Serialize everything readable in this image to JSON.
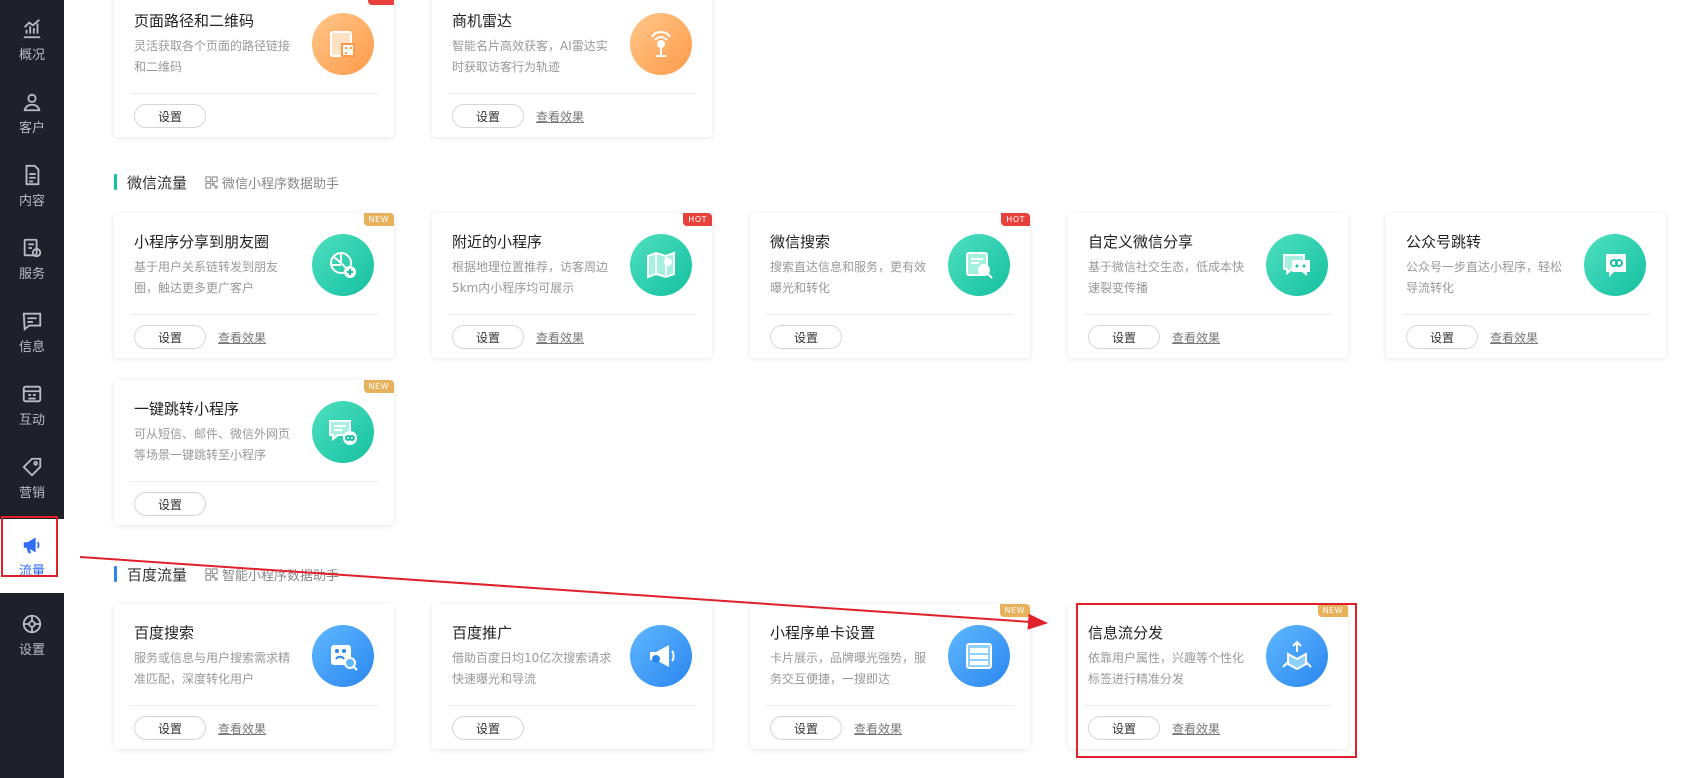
{
  "sidebar": {
    "items": [
      {
        "label": "概况",
        "icon": "chart-icon"
      },
      {
        "label": "客户",
        "icon": "user-icon"
      },
      {
        "label": "内容",
        "icon": "document-icon"
      },
      {
        "label": "服务",
        "icon": "service-icon"
      },
      {
        "label": "信息",
        "icon": "message-icon"
      },
      {
        "label": "互动",
        "icon": "interaction-icon"
      },
      {
        "label": "营销",
        "icon": "tag-icon"
      },
      {
        "label": "流量",
        "icon": "megaphone-icon"
      },
      {
        "label": "设置",
        "icon": "gear-icon"
      }
    ],
    "active": "流量"
  },
  "top_cards": [
    {
      "title": "页面路径和二维码",
      "desc": "灵活获取各个页面的路径链接和二维码",
      "button": "设置",
      "link": "",
      "icon": "qrcode-page-icon"
    },
    {
      "title": "商机雷达",
      "desc": "智能名片高效获客，AI雷达实时获取访客行为轨迹",
      "button": "设置",
      "link": "查看效果",
      "icon": "radar-icon"
    }
  ],
  "sections": [
    {
      "name": "微信流量",
      "helper": "微信小程序数据助手",
      "cards": [
        {
          "title": "小程序分享到朋友圈",
          "desc": "基于用户关系链转发到朋友圈，触达更多更广客户",
          "button": "设置",
          "link": "查看效果",
          "badge": "NEW",
          "icon": "moments-icon"
        },
        {
          "title": "附近的小程序",
          "desc": "根据地理位置推荐，访客周边5km内小程序均可展示",
          "button": "设置",
          "link": "查看效果",
          "badge": "HOT",
          "icon": "map-icon"
        },
        {
          "title": "微信搜索",
          "desc": "搜索直达信息和服务，更有效曝光和转化",
          "button": "设置",
          "link": "",
          "badge": "HOT",
          "icon": "search-page-icon"
        },
        {
          "title": "自定义微信分享",
          "desc": "基于微信社交生态，低成本快速裂变传播",
          "button": "设置",
          "link": "查看效果",
          "badge": "",
          "icon": "wechat-icon"
        },
        {
          "title": "公众号跳转",
          "desc": "公众号一步直达小程序，轻松导流转化",
          "button": "设置",
          "link": "查看效果",
          "badge": "",
          "icon": "official-account-icon"
        },
        {
          "title": "一键跳转小程序",
          "desc": "可从短信、邮件、微信外网页等场景一键跳转至小程序",
          "button": "设置",
          "link": "",
          "badge": "NEW",
          "icon": "jump-icon"
        }
      ]
    },
    {
      "name": "百度流量",
      "helper": "智能小程序数据助手",
      "cards": [
        {
          "title": "百度搜索",
          "desc": "服务或信息与用户搜索需求精准匹配，深度转化用户",
          "button": "设置",
          "link": "查看效果",
          "badge": "",
          "icon": "baidu-search-icon"
        },
        {
          "title": "百度推广",
          "desc": "借助百度日均10亿次搜索请求快速曝光和导流",
          "button": "设置",
          "link": "",
          "badge": "",
          "icon": "baidu-promo-icon"
        },
        {
          "title": "小程序单卡设置",
          "desc": "卡片展示，品牌曝光强势，服务交互便捷，一搜即达",
          "button": "设置",
          "link": "查看效果",
          "badge": "NEW",
          "icon": "card-list-icon"
        },
        {
          "title": "信息流分发",
          "desc": "依靠用户属性，兴趣等个性化标签进行精准分发",
          "button": "设置",
          "link": "查看效果",
          "badge": "NEW",
          "icon": "distribute-icon"
        }
      ]
    }
  ],
  "colors": {
    "sidebar_bg": "#1f2128",
    "active": "#2f6cf6",
    "highlight": "#e0202b",
    "wechat_accent": "#14c0a0",
    "baidu_accent": "#2b86f0"
  }
}
